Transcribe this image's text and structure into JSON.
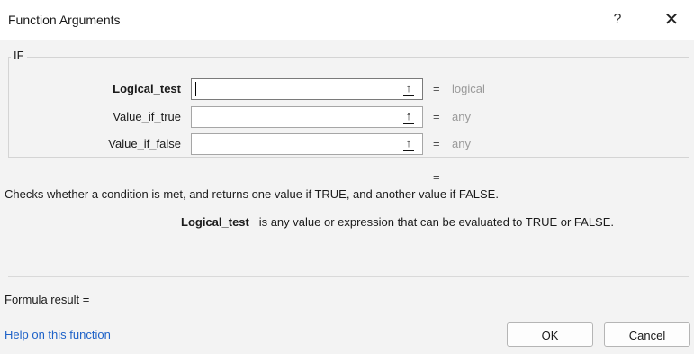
{
  "window": {
    "title": "Function Arguments",
    "help_glyph": "?",
    "close_glyph": "✕"
  },
  "function": {
    "name": "IF",
    "arguments": [
      {
        "label": "Logical_test",
        "value": "",
        "result_hint": "logical"
      },
      {
        "label": "Value_if_true",
        "value": "",
        "result_hint": "any"
      },
      {
        "label": "Value_if_false",
        "value": "",
        "result_hint": "any"
      }
    ],
    "equals": "=",
    "result_equals": "=",
    "description": "Checks whether a condition is met, and returns one value if TRUE, and another value if FALSE.",
    "arg_help_name": "Logical_test",
    "arg_help_text": "is any value or expression that can be evaluated to TRUE or FALSE."
  },
  "footer": {
    "formula_result_label": "Formula result =",
    "help_link": "Help on this function",
    "ok_label": "OK",
    "cancel_label": "Cancel"
  },
  "icons": {
    "collapse": "collapse-dialog-icon"
  },
  "colors": {
    "link": "#1e62c8",
    "hint": "#9a9a9a",
    "dialog_bg": "#f3f3f3"
  }
}
